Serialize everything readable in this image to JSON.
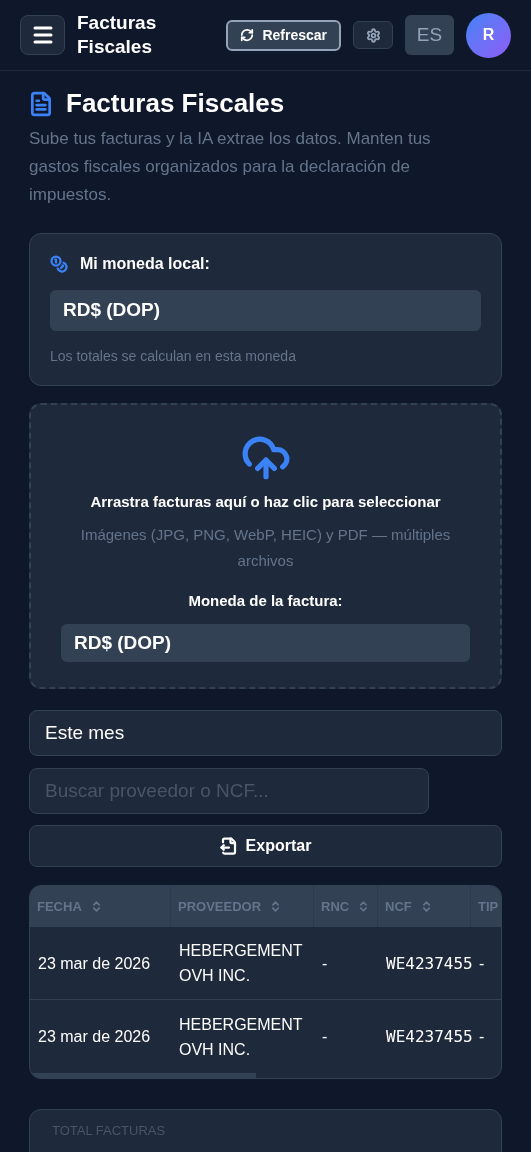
{
  "header": {
    "title": "Facturas Fiscales",
    "refresh_button": "Refrescar",
    "language_button": "ES",
    "avatar": "R"
  },
  "page": {
    "title": "Facturas Fiscales",
    "description": "Sube tus facturas y la IA extrae los datos. Manten tus gastos fiscales organizados para la declaración de impuestos."
  },
  "local_currency": {
    "label": "Mi moneda local:",
    "value": "RD$ (DOP)",
    "hint": "Los totales se calculan en esta moneda"
  },
  "upload": {
    "title": "Arrastra facturas aquí o haz clic para seleccionar",
    "subtitle": "Imágenes (JPG, PNG, WebP, HEIC) y PDF — múltiples archivos",
    "currency_label": "Moneda de la factura:",
    "currency_value": "RD$ (DOP)"
  },
  "period": {
    "value": "Este mes"
  },
  "search": {
    "placeholder": "Buscar proveedor o NCF..."
  },
  "export_button": "Exportar",
  "table": {
    "columns": [
      {
        "label": "FECHA",
        "sortable": true
      },
      {
        "label": "PROVEEDOR",
        "sortable": true
      },
      {
        "label": "RNC",
        "sortable": true
      },
      {
        "label": "NCF",
        "sortable": true
      },
      {
        "label": "TIP"
      }
    ],
    "rows": [
      [
        "23 mar de 2026",
        "HEBERGEMENT OVH INC.",
        "-",
        "WE4237455",
        "-"
      ],
      [
        "23 mar de 2026",
        "HEBERGEMENT OVH INC.",
        "-",
        "WE4237455",
        "-"
      ]
    ]
  },
  "summary": {
    "label": "TOTAL FACTURAS"
  }
}
